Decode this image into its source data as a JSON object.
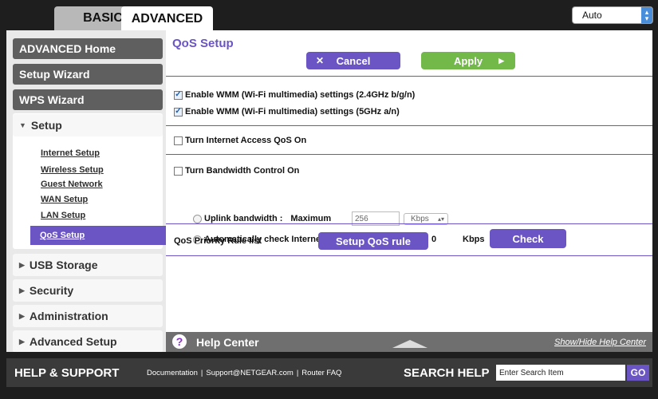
{
  "tabs": {
    "basic": "BASIC",
    "advanced": "ADVANCED"
  },
  "language": {
    "selected": "Auto"
  },
  "sidebar": {
    "advanced_home": "ADVANCED Home",
    "setup_wizard": "Setup Wizard",
    "wps_wizard": "WPS Wizard",
    "setup": "Setup",
    "setup_items": [
      "Internet Setup",
      "Wireless Setup",
      "Guest Network",
      "WAN Setup",
      "LAN Setup",
      "QoS Setup"
    ],
    "usb_storage": "USB Storage",
    "security": "Security",
    "administration": "Administration",
    "advanced_setup": "Advanced Setup"
  },
  "main": {
    "title": "QoS Setup",
    "cancel": "Cancel",
    "apply": "Apply",
    "wmm_24": "Enable WMM (Wi-Fi multimedia) settings (2.4GHz b/g/n)",
    "wmm_5": "Enable WMM (Wi-Fi multimedia) settings (5GHz a/n)",
    "wmm_24_checked": true,
    "wmm_5_checked": true,
    "internet_qos": "Turn Internet Access QoS On",
    "bandwidth_control": "Turn Bandwidth Control On",
    "uplink_label": "Uplink bandwidth :",
    "maximum_label": "Maximum",
    "uplink_value": "256",
    "uplink_unit": "Kbps",
    "auto_check_label": "Automatically check Internet Uplink bandwidth :",
    "auto_value": "0",
    "auto_unit": "Kbps",
    "check_button": "Check",
    "rule_list_label": "QoS Priority Rule list",
    "setup_rule_button": "Setup QoS rule"
  },
  "help_center": {
    "title": "Help Center",
    "toggle": "Show/Hide Help Center"
  },
  "footer": {
    "title": "HELP & SUPPORT",
    "links": [
      "Documentation",
      "Support@NETGEAR.com",
      "Router FAQ"
    ],
    "search_title": "SEARCH HELP",
    "search_placeholder": "Enter Search Item",
    "go": "GO"
  },
  "colors": {
    "accent_purple": "#6b54c4",
    "apply_green": "#72b94a",
    "nav_dark": "#5f5f5f"
  }
}
